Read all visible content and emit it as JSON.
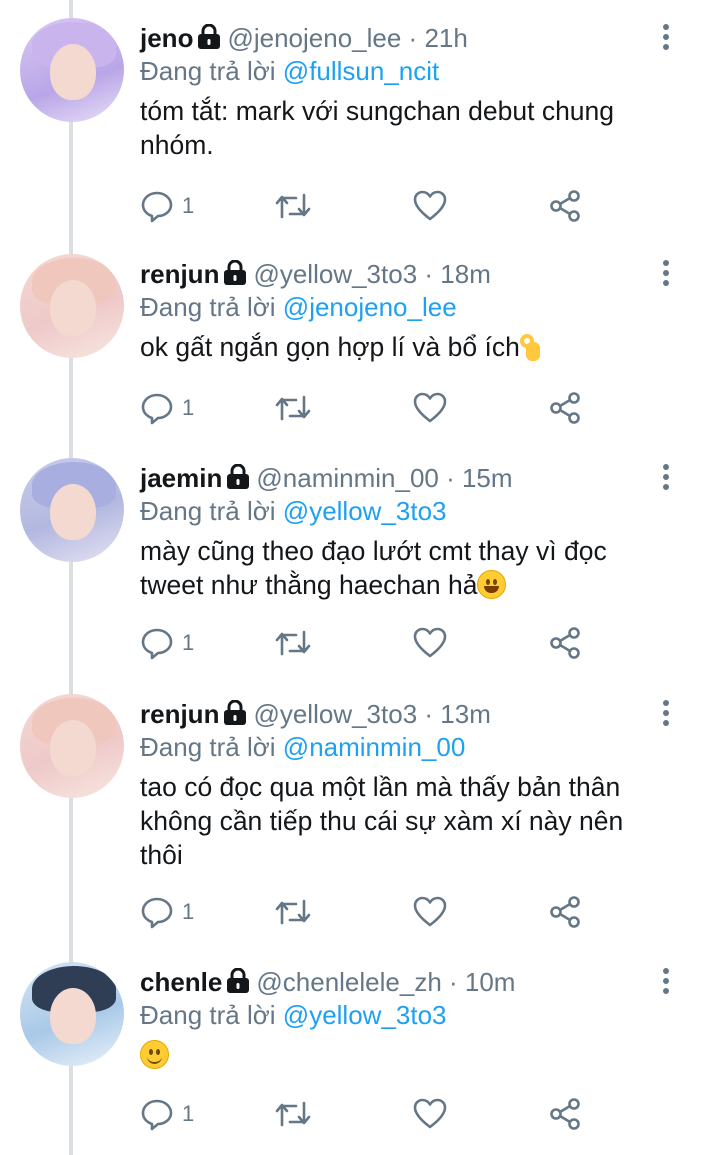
{
  "labels": {
    "replying_to": "Đang trả lời"
  },
  "colors": {
    "link": "#1da1f2",
    "secondary_text": "#657786",
    "thread_line": "#dcdfe2"
  },
  "tweets": [
    {
      "name": "jeno",
      "handle": "@jenojeno_lee",
      "time": "21h",
      "reply_to": "@fullsun_ncit",
      "text": "tóm tắt: mark với sungchan debut chung nhóm.",
      "emoji": "",
      "reply_count": "1"
    },
    {
      "name": "renjun",
      "handle": "@yellow_3to3",
      "time": "18m",
      "reply_to": "@jenojeno_lee",
      "text": "ok gất ngắn gọn hợp lí và bổ ích",
      "emoji": "ok-hand",
      "reply_count": "1"
    },
    {
      "name": "jaemin",
      "handle": "@naminmin_00",
      "time": "15m",
      "reply_to": "@yellow_3to3",
      "text": "mày cũng theo đạo lướt cmt thay vì đọc tweet như thằng haechan hả",
      "emoji": "grinning-face",
      "reply_count": "1"
    },
    {
      "name": "renjun",
      "handle": "@yellow_3to3",
      "time": "13m",
      "reply_to": "@naminmin_00",
      "text": "tao có đọc qua một lần mà thấy bản thân không cần tiếp thu cái sự xàm xí này nên thôi",
      "emoji": "",
      "reply_count": "1"
    },
    {
      "name": "chenle",
      "handle": "@chenlelele_zh",
      "time": "10m",
      "reply_to": "@yellow_3to3",
      "text": "",
      "emoji": "slightly-smiling-face",
      "reply_count": "1"
    }
  ]
}
